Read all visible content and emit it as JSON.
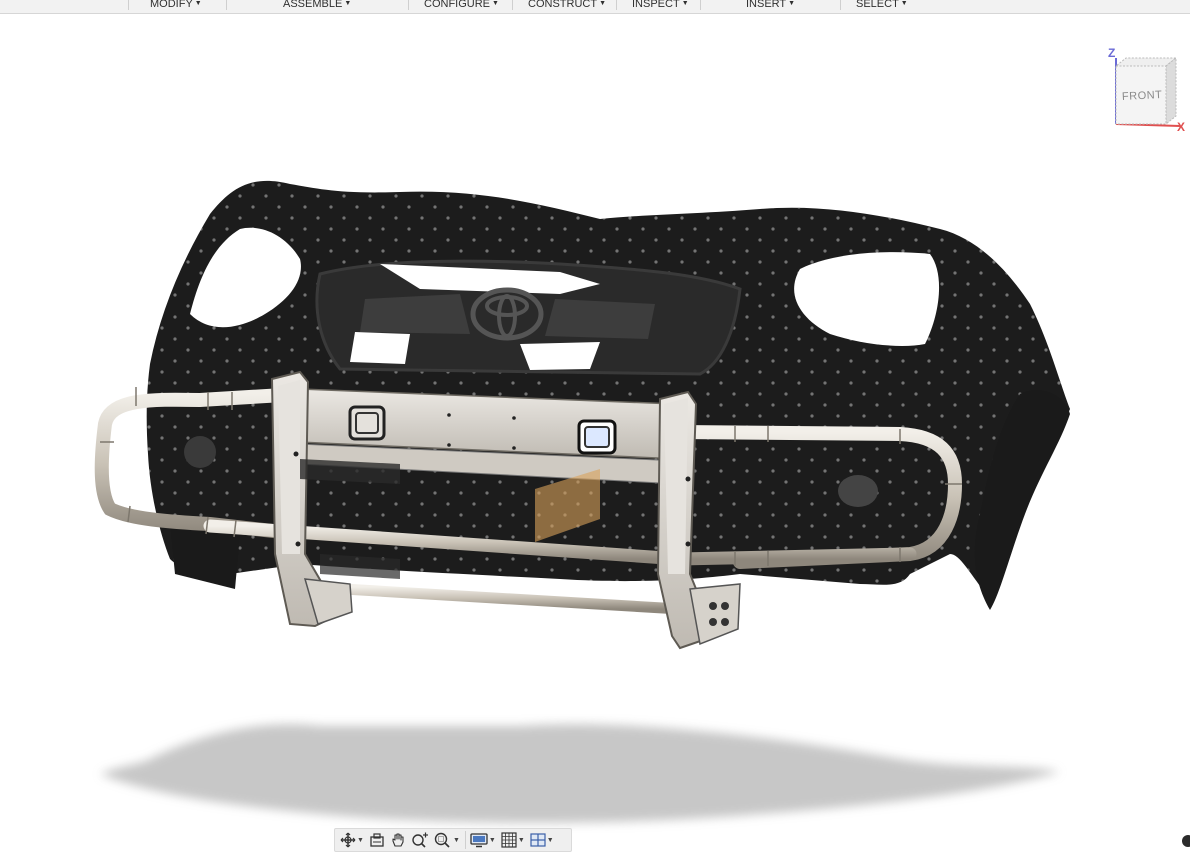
{
  "toolbar": {
    "menus": [
      {
        "label": "MODIFY"
      },
      {
        "label": "ASSEMBLE"
      },
      {
        "label": "CONFIGURE"
      },
      {
        "label": "CONSTRUCT"
      },
      {
        "label": "INSPECT"
      },
      {
        "label": "INSERT"
      },
      {
        "label": "SELECT"
      }
    ]
  },
  "viewcube": {
    "face_label": "FRONT",
    "axis_z": "Z",
    "axis_x": "X"
  },
  "navbar": {
    "tools": [
      {
        "icon": "orbit-icon"
      },
      {
        "icon": "look-at-icon"
      },
      {
        "icon": "pan-hand-icon"
      },
      {
        "icon": "zoom-icon"
      },
      {
        "icon": "zoom-window-icon"
      },
      {
        "icon": "display-settings-icon"
      },
      {
        "icon": "grid-icon"
      },
      {
        "icon": "viewports-icon"
      }
    ]
  },
  "colors": {
    "toolbar_bg": "#f2f2f2",
    "scan_body": "#1c1c1c",
    "bumper_tube": "#cfc8bd",
    "bumper_plate": "#d9d6d0",
    "shadow": "#cfcfcf",
    "axis_z": "#6a6ad6",
    "axis_x": "#e05050"
  }
}
